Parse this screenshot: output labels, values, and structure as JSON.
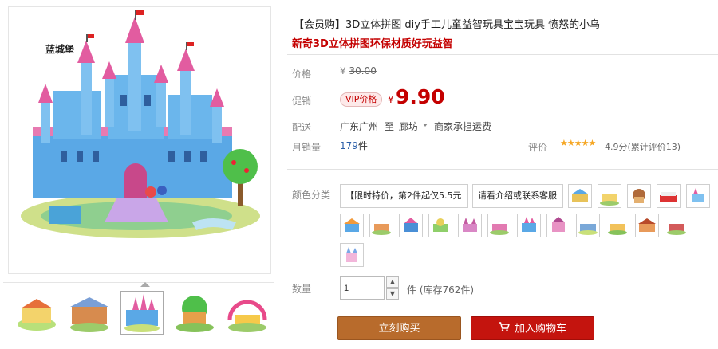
{
  "product": {
    "title": "【会员购】3D立体拼图 diy手工儿童益智玩具宝宝玩具 愤怒的小鸟",
    "subtitle": "新奇3D立体拼图环保材质好玩益智"
  },
  "gallery": {
    "main_caption": "蓝城堡",
    "thumbnail_count": 5,
    "active_index": 2
  },
  "price": {
    "label": "价格",
    "currency": "¥",
    "original": "30.00"
  },
  "promo": {
    "label": "促销",
    "badge": "VIP价格",
    "currency": "¥",
    "price": "9.90"
  },
  "shipping": {
    "label": "配送",
    "from": "广东广州",
    "to_word": "至",
    "to": "廊坊",
    "fee": "商家承担运费"
  },
  "sales": {
    "label": "月销量",
    "count": "179",
    "unit": "件"
  },
  "review": {
    "label": "评价",
    "stars": "★★★★★",
    "summary": "4.9分(累计评价13)"
  },
  "options": {
    "label": "颜色分类",
    "text_options": [
      "【限时特价，第2件起仅5.5元",
      "请看介绍或联系客服"
    ]
  },
  "quantity": {
    "label": "数量",
    "value": "1",
    "up_icon": "▲",
    "down_icon": "▼",
    "stock": "件 (库存762件)"
  },
  "actions": {
    "buy_now": "立刻购买",
    "add_to_cart": "加入购物车"
  },
  "colors": {
    "price_red": "#c40000",
    "buy_button": "#b86b2c",
    "cart_button": "#c4140e",
    "link_blue": "#2a5ea8"
  }
}
